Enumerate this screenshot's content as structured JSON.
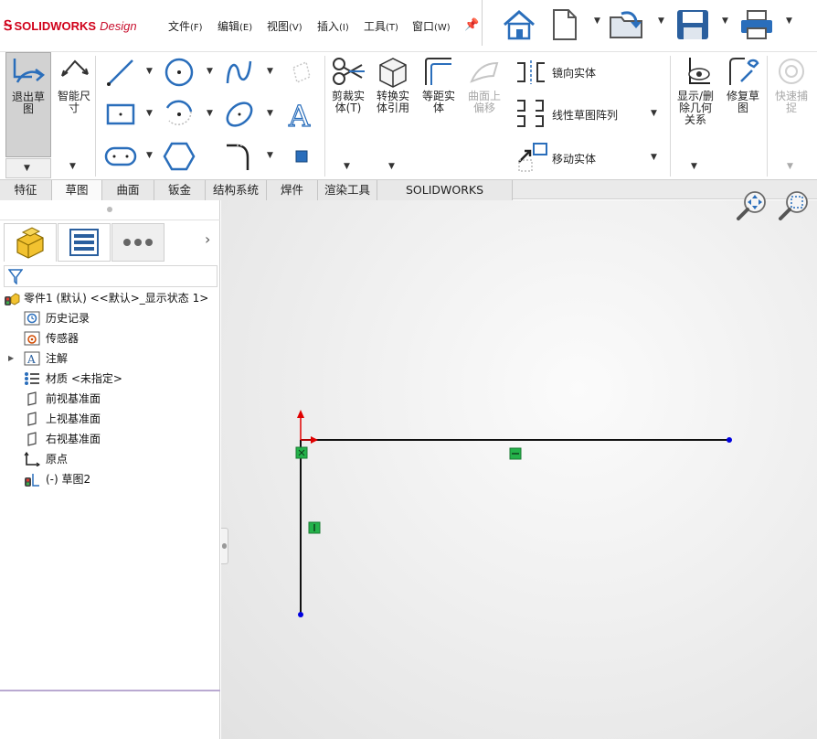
{
  "app": {
    "brand_prefix": "SOLID",
    "brand_bold": "WORKS",
    "brand_suffix": "Design"
  },
  "menu": [
    {
      "label": "文件",
      "key": "(F)"
    },
    {
      "label": "编辑",
      "key": "(E)"
    },
    {
      "label": "视图",
      "key": "(V)"
    },
    {
      "label": "插入",
      "key": "(I)"
    },
    {
      "label": "工具",
      "key": "(T)"
    },
    {
      "label": "窗口",
      "key": "(W)"
    }
  ],
  "quick_access": [
    "home-icon",
    "new-document-icon",
    "open-file-icon",
    "save-icon",
    "print-icon"
  ],
  "ribbon": {
    "exit_sketch": "退出草\n图",
    "smart_dim": "智能尺\n寸",
    "trim": "剪裁实\n体(T)",
    "convert": "转换实\n体引用",
    "offset": "等距实\n体",
    "surface_offset": "曲面上\n偏移",
    "mirror": "镜向实体",
    "linear_pattern": "线性草图阵列",
    "move": "移动实体",
    "display_delete": "显示/删\n除几何\n关系",
    "repair": "修复草\n图",
    "quick_snap": "快速捕\n捉"
  },
  "tabs": [
    "特征",
    "草图",
    "曲面",
    "钣金",
    "结构系统",
    "焊件",
    "渲染工具",
    "SOLIDWORKS Inspection"
  ],
  "active_tab": "草图",
  "tree": {
    "root": "零件1 (默认) <<默认>_显示状态 1>",
    "items": [
      "历史记录",
      "传感器",
      "注解",
      "材质 <未指定>",
      "前视基准面",
      "上视基准面",
      "右视基准面",
      "原点",
      "(-) 草图2"
    ]
  },
  "colors": {
    "brand": "#d0021b",
    "accent": "#2a6ebb",
    "relation": "#24b24a",
    "endpoint": "#0000e0",
    "origin": "#e00000"
  }
}
